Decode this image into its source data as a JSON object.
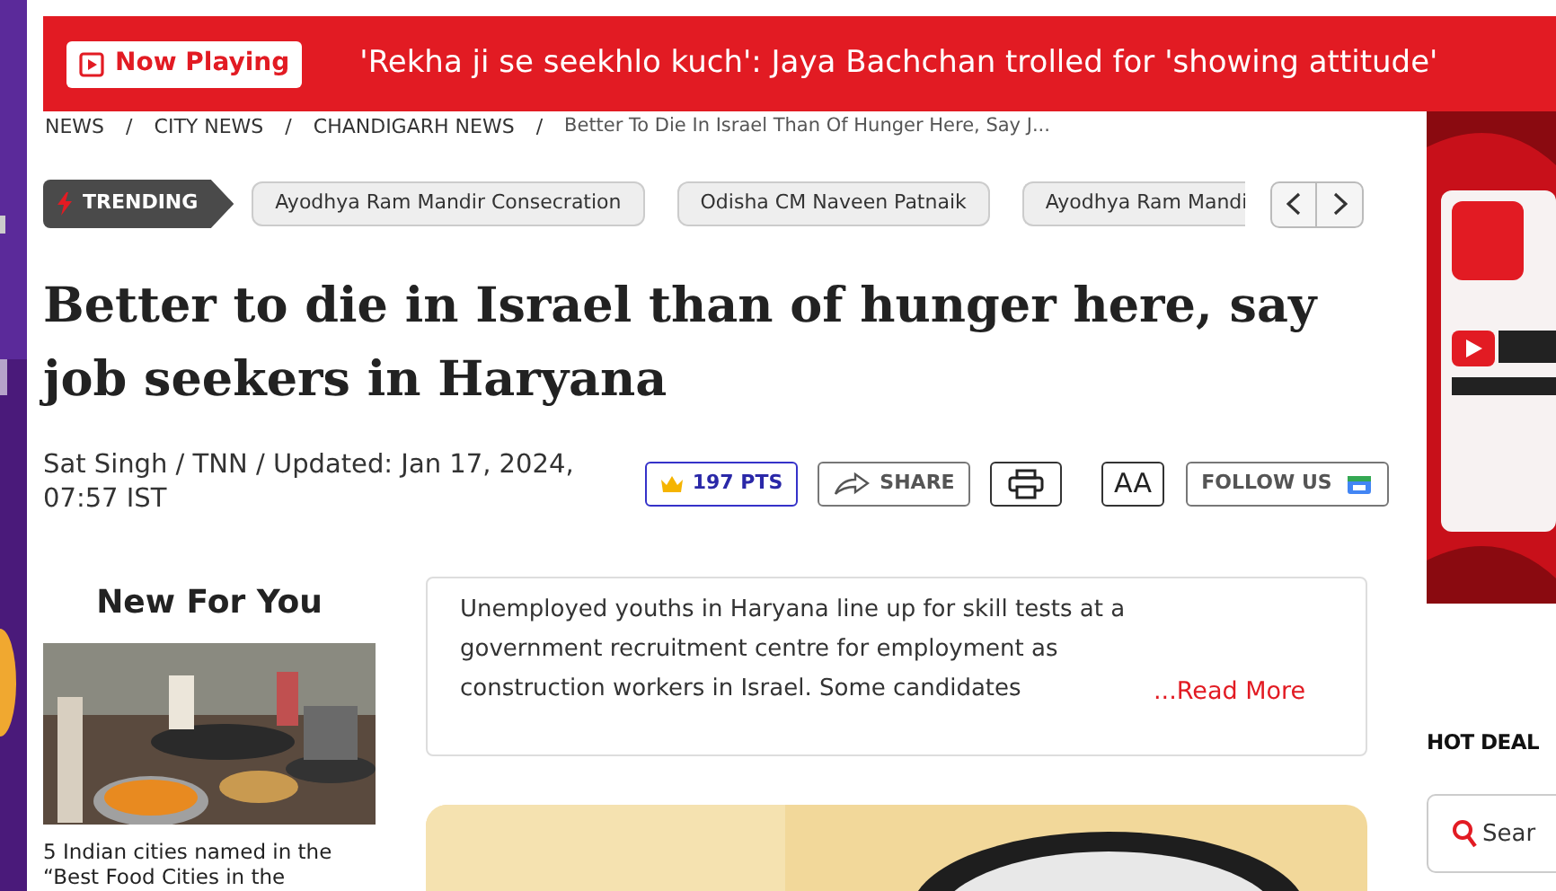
{
  "now_playing": {
    "label": "Now Playing",
    "headline": "'Rekha ji se seekhlo kuch': Jaya Bachchan trolled for 'showing attitude'"
  },
  "breadcrumb": {
    "separator": "/",
    "items": [
      "NEWS",
      "CITY NEWS",
      "CHANDIGARH NEWS",
      "Better To Die In Israel Than Of Hunger Here, Say J..."
    ]
  },
  "trending": {
    "label": "TRENDING",
    "items": [
      "Ayodhya Ram Mandir Consecration",
      "Odisha CM Naveen Patnaik",
      "Ayodhya Ram Mandi"
    ]
  },
  "article": {
    "title": "Better to die in Israel than of hunger here, say job seekers in Haryana",
    "byline": "Sat Singh / TNN / Updated: Jan 17, 2024, 07:57 IST",
    "points": "197 PTS",
    "share": "SHARE",
    "font_size": "AA",
    "follow": "FOLLOW US",
    "summary": "Unemployed youths in Haryana line up for skill tests at a government recruitment centre for employment as construction workers in Israel. Some candidates",
    "read_more": "...Read More"
  },
  "new_for_you": {
    "title": "New For You",
    "items": [
      {
        "caption": "5 Indian cities named in the “Best Food Cities in the"
      }
    ]
  },
  "hot_deals": {
    "title": "HOT DEAL",
    "search_placeholder": "Sear"
  }
}
